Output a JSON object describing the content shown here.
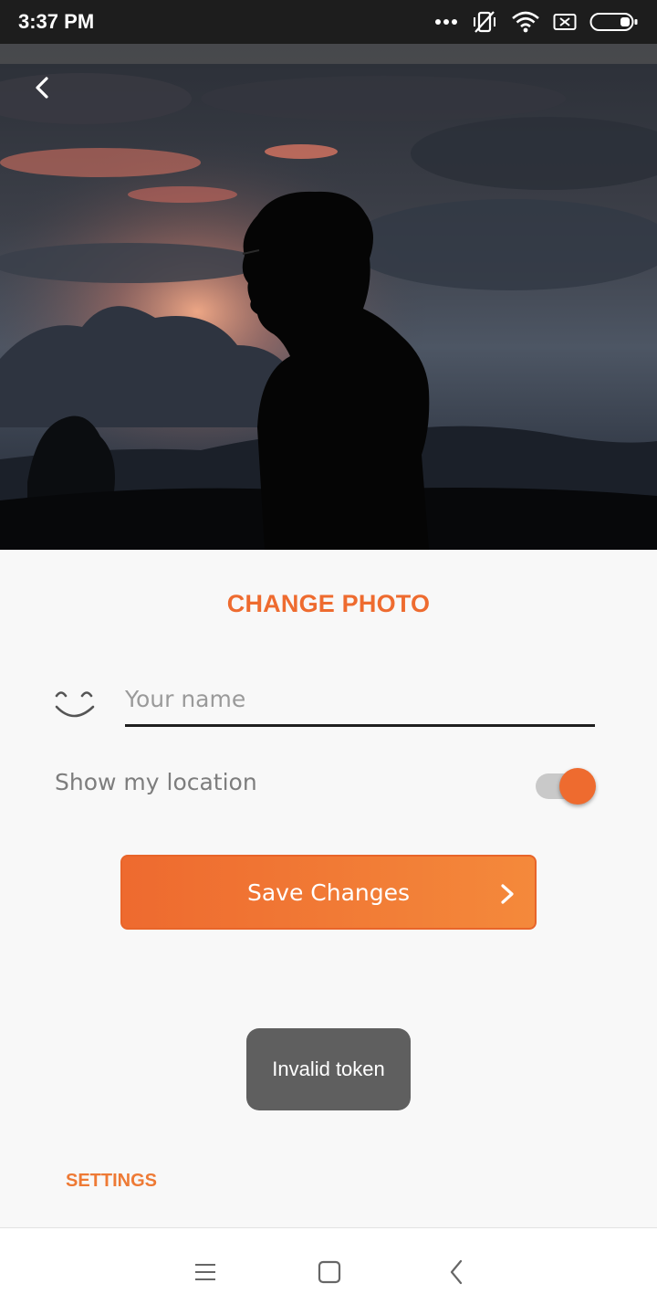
{
  "status_bar": {
    "time": "3:37 PM",
    "icons": [
      "more-dots-icon",
      "vibrate-off-icon",
      "wifi-icon",
      "sim-missing-icon",
      "battery-icon"
    ]
  },
  "hero": {
    "image": "profile-photo-silhouette-sunset",
    "back_icon": "chevron-left-icon"
  },
  "profile": {
    "change_photo_label": "CHANGE PHOTO",
    "name_icon": "smile-icon",
    "name_input": {
      "value": "",
      "placeholder": "Your name"
    },
    "location_label": "Show my location",
    "location_toggle_on": true,
    "save_button_label": "Save Changes",
    "save_button_icon": "chevron-right-icon"
  },
  "toast": {
    "message": "Invalid token"
  },
  "footer": {
    "settings_label": "SETTINGS"
  },
  "nav_bar": {
    "icons": [
      "menu-icon",
      "home-square-icon",
      "back-icon"
    ]
  },
  "colors": {
    "accent": "#ee6b2f",
    "accent_light": "#f4893b",
    "background": "#f8f8f8",
    "status_bar": "#1d1d1d",
    "toast_bg": "#5f5f5f"
  }
}
